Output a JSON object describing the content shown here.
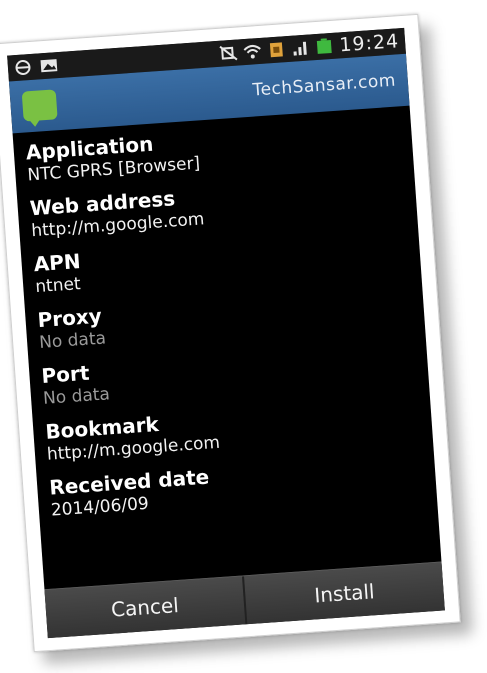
{
  "status_bar": {
    "time": "19:24",
    "icons": [
      "steering-wheel-icon",
      "image-icon",
      "mute-icon",
      "wifi-icon",
      "sim-icon",
      "signal-icon",
      "battery-icon"
    ]
  },
  "title_bar": {
    "app_icon": "message-bubble-icon",
    "title": "TechSansar.com"
  },
  "fields": [
    {
      "label": "Application",
      "value": "NTC GPRS [Browser]",
      "empty": false
    },
    {
      "label": "Web address",
      "value": "http://m.google.com",
      "empty": false
    },
    {
      "label": "APN",
      "value": "ntnet",
      "empty": false
    },
    {
      "label": "Proxy",
      "value": "No data",
      "empty": true
    },
    {
      "label": "Port",
      "value": "No data",
      "empty": true
    },
    {
      "label": "Bookmark",
      "value": "http://m.google.com",
      "empty": false
    },
    {
      "label": "Received date",
      "value": "2014/06/09",
      "empty": false
    }
  ],
  "buttons": {
    "cancel": "Cancel",
    "install": "Install"
  },
  "colors": {
    "title_bar": "#2f5f93",
    "app_icon": "#7ac143",
    "screen_bg": "#000000",
    "muted_text": "#9a9a9a"
  }
}
